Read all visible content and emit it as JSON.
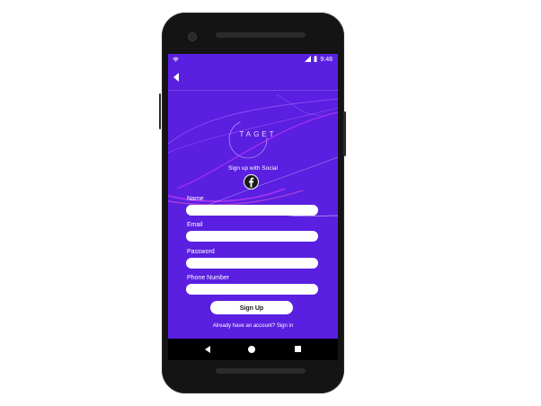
{
  "status_bar": {
    "time": "9:48",
    "wifi_icon": "wifi-icon",
    "signal_icon": "signal-icon",
    "battery_icon": "battery-icon"
  },
  "app_bar": {
    "back_icon": "arrow-back-icon"
  },
  "brand": {
    "logo_text": "TAGET"
  },
  "social": {
    "prompt": "Sign up with Social",
    "icon": "facebook-icon",
    "facebook_color": "#1877f2"
  },
  "form": {
    "name_label": "Name",
    "email_label": "Email",
    "password_label": "Password",
    "phone_label": "Phone Number",
    "name_value": "",
    "email_value": "",
    "password_value": "",
    "phone_value": ""
  },
  "actions": {
    "signup_label": "Sign Up",
    "signin_text": "Already have an account? Sign in"
  },
  "colors": {
    "background": "#5a1fe0",
    "accent_wave": "#e040fb",
    "field": "#ffffff"
  },
  "nav": {
    "back_icon": "nav-back-icon",
    "home_icon": "nav-home-icon",
    "recent_icon": "nav-recents-icon"
  }
}
